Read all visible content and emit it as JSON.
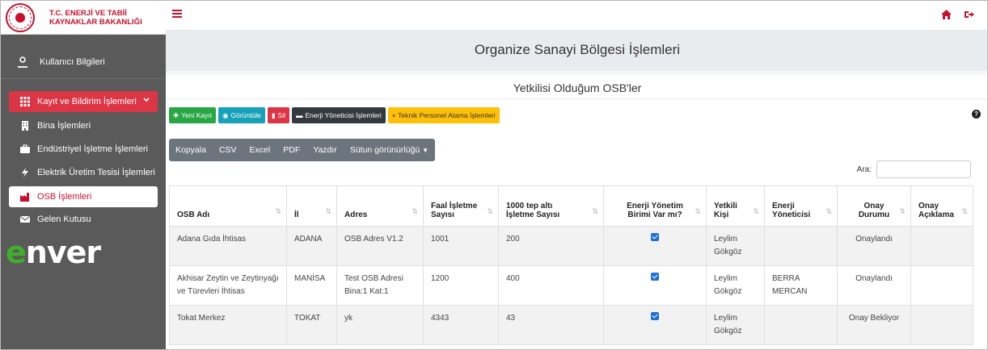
{
  "brand": {
    "line1": "T.C. ENERJİ VE TABİİ",
    "line2": "KAYNAKLAR BAKANLIĞI"
  },
  "sidebar": {
    "user": "Kullanıcı Bilgileri",
    "menu_main": "Kayıt ve Bildirim İşlemleri",
    "items": [
      "Bina İşlemleri",
      "Endüstriyel İşletme İşlemleri",
      "Elektrik Üretim Tesisi İşlemleri",
      "OSB İşlemleri",
      "Gelen Kutusu"
    ],
    "logo_e": "e",
    "logo_rest": "nver"
  },
  "page": {
    "title": "Organize Sanayi Bölgesi İşlemleri",
    "card_title": "Yetkilisi Olduğum OSB'ler"
  },
  "toolbar": {
    "new": "Yeni Kayıt",
    "view": "Görüntüle",
    "delete": "Sil",
    "energy_manager": "Enerji Yöneticisi İşlemleri",
    "tech_staff": "Teknik Personel Atama İşlemleri"
  },
  "export": [
    "Kopyala",
    "CSV",
    "Excel",
    "PDF",
    "Yazdır",
    "Sütun görünürlüğü"
  ],
  "search": {
    "label": "Ara:"
  },
  "table": {
    "headers": [
      "OSB Adı",
      "İl",
      "Adres",
      "Faal İşletme Sayısı",
      "1000 tep altı İşletme Sayısı",
      "Enerji Yönetim Birimi Var mı?",
      "Yetkili Kişi",
      "Enerji Yöneticisi",
      "Onay Durumu",
      "Onay Açıklama"
    ],
    "rows": [
      {
        "name": "Adana Gıda İhtisas",
        "il": "ADANA",
        "adres": "OSB Adres V1.2",
        "faal": "1001",
        "tep": "200",
        "ebr": true,
        "yetkili": "Leylim Gökgöz",
        "yonetici": "",
        "onay": "Onaylandı",
        "aciklama": ""
      },
      {
        "name": "Akhisar Zeytin ve Zeytinyağı ve Türevleri İhtisas",
        "il": "MANİSA",
        "adres": "Test OSB Adresi Bina:1 Kat:1",
        "faal": "1200",
        "tep": "400",
        "ebr": true,
        "yetkili": "Leylim Gökgöz",
        "yonetici": "BERRA MERCAN",
        "onay": "Onaylandı",
        "aciklama": ""
      },
      {
        "name": "Tokat Merkez",
        "il": "TOKAT",
        "adres": "yk",
        "faal": "4343",
        "tep": "43",
        "ebr": true,
        "yetkili": "Leylim Gökgöz",
        "yonetici": "",
        "onay": "Onay Bekliyor",
        "aciklama": ""
      }
    ]
  },
  "colors": {
    "accent": "#c8102e",
    "sidebar": "#5a5a5a",
    "green": "#28a745",
    "teal": "#17a2b8",
    "red": "#dc3545",
    "yellow": "#ffc107"
  }
}
